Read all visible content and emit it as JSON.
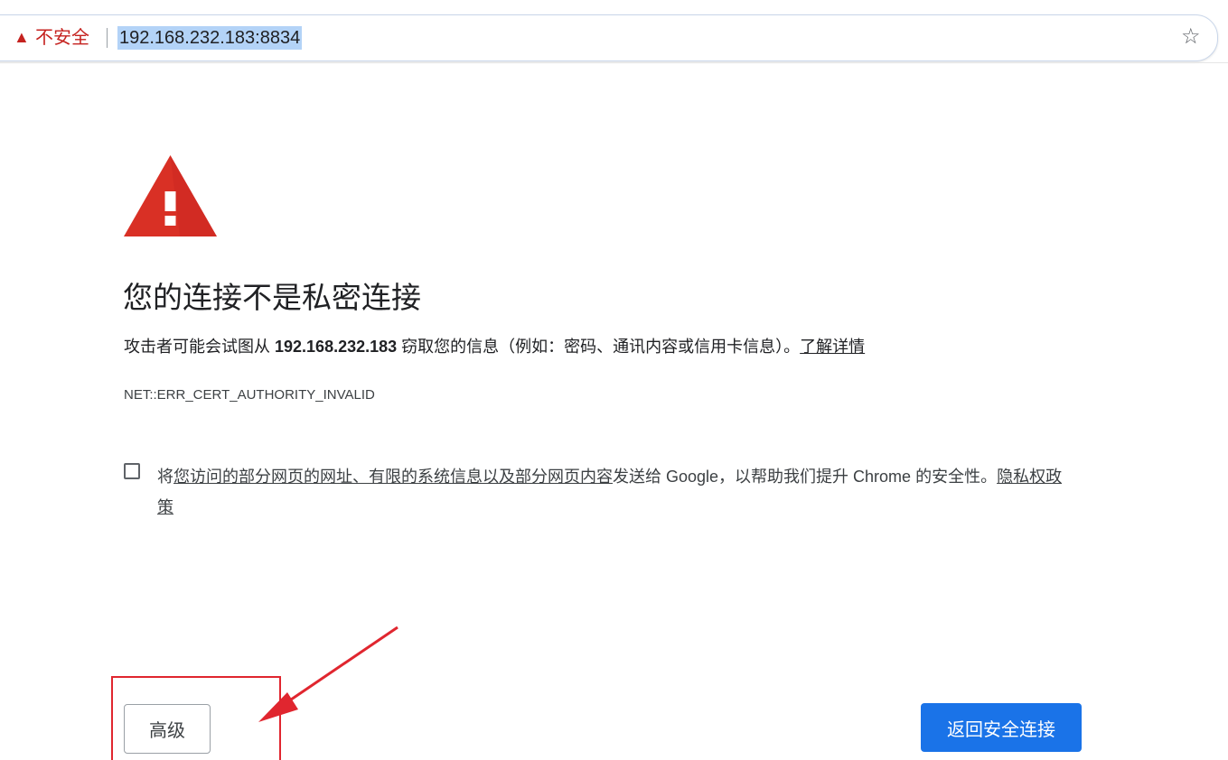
{
  "omnibox": {
    "security_label": "不安全",
    "url": "192.168.232.183:8834",
    "warning_icon": "warning-triangle-icon",
    "bookmark_icon": "star-icon"
  },
  "interstitial": {
    "icon": "warning-triangle-icon",
    "heading": "您的连接不是私密连接",
    "desc_prefix": "攻击者可能会试图从 ",
    "desc_host": "192.168.232.183",
    "desc_suffix": " 窃取您的信息（例如：密码、通讯内容或信用卡信息）。",
    "learn_more": "了解详情",
    "error_code": "NET::ERR_CERT_AUTHORITY_INVALID",
    "opt_in": {
      "checked": false,
      "prefix": "将",
      "link": "您访问的部分网页的网址、有限的系统信息以及部分网页内容",
      "middle": "发送给 Google，以帮助我们提升 Chrome 的安全性。",
      "privacy_link": "隐私权政策"
    },
    "advanced_button": "高级",
    "back_button": "返回安全连接"
  },
  "annotation": {
    "color": "#e0262f"
  }
}
